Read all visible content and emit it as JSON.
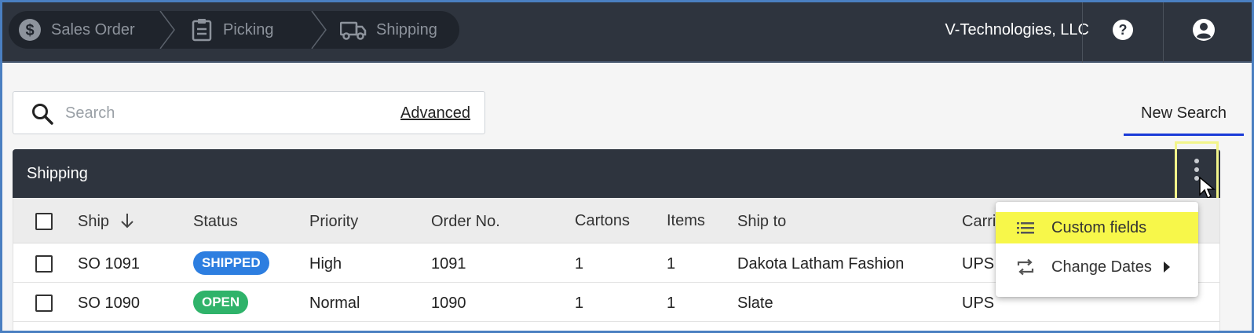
{
  "topbar": {
    "crumbs": [
      {
        "label": "Sales Order",
        "icon": "dollar-icon"
      },
      {
        "label": "Picking",
        "icon": "clipboard-icon"
      },
      {
        "label": "Shipping",
        "icon": "truck-icon"
      }
    ],
    "company": "V-Technologies, LLC",
    "help_icon": "help-icon",
    "account_icon": "account-icon"
  },
  "search": {
    "placeholder": "Search",
    "value": "",
    "advanced_label": "Advanced"
  },
  "tabs": {
    "new_search": "New Search"
  },
  "panel": {
    "title": "Shipping"
  },
  "table": {
    "columns": [
      "Ship",
      "Status",
      "Priority",
      "Order No.",
      "Cartons",
      "Items",
      "Ship to",
      "Carri"
    ],
    "rows": [
      {
        "ship": "SO 1091",
        "status": "SHIPPED",
        "priority": "High",
        "order_no": "1091",
        "cartons": "1",
        "items": "1",
        "ship_to": "Dakota Latham Fashion",
        "carrier": "UPS"
      },
      {
        "ship": "SO 1090",
        "status": "OPEN",
        "priority": "Normal",
        "order_no": "1090",
        "cartons": "1",
        "items": "1",
        "ship_to": "Slate",
        "carrier": "UPS"
      }
    ]
  },
  "menu": {
    "items": [
      {
        "label": "Custom fields",
        "icon": "list-icon",
        "highlighted": true
      },
      {
        "label": "Change Dates",
        "icon": "swap-icon",
        "has_submenu": true
      }
    ]
  },
  "colors": {
    "topbar": "#2e343e",
    "shipped_badge": "#2d7ee0",
    "open_badge": "#2fb36a",
    "tab_underline": "#1a3ad8",
    "menu_highlight": "#f7f74a"
  }
}
